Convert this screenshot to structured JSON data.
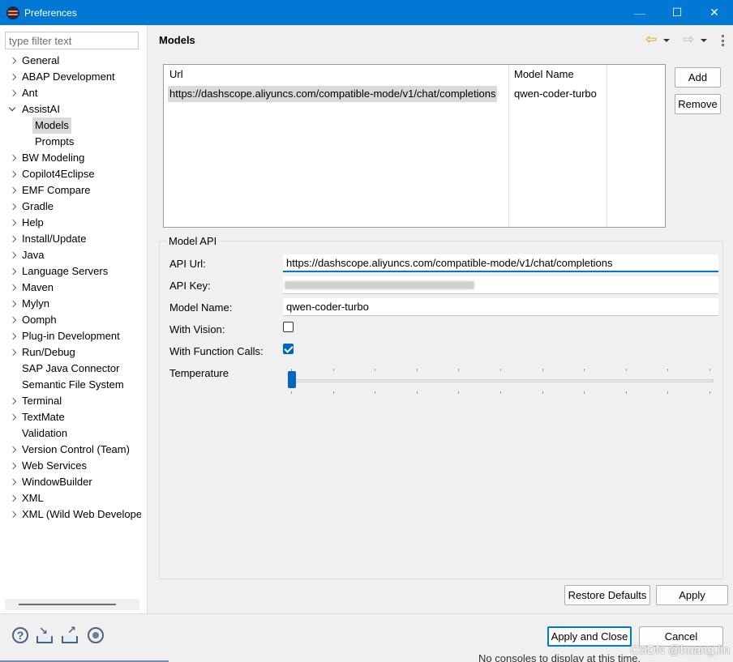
{
  "window": {
    "title": "Preferences",
    "minimize_glyph": "—",
    "maximize_glyph": "☐",
    "close_glyph": "✕"
  },
  "filter": {
    "placeholder": "type filter text",
    "value": ""
  },
  "tree": [
    {
      "label": "General",
      "arrow": "collapsed"
    },
    {
      "label": "ABAP Development",
      "arrow": "collapsed"
    },
    {
      "label": "Ant",
      "arrow": "collapsed"
    },
    {
      "label": "AssistAI",
      "arrow": "expanded"
    },
    {
      "label": "Models",
      "arrow": "none",
      "child": true,
      "selected": true
    },
    {
      "label": "Prompts",
      "arrow": "none",
      "child": true
    },
    {
      "label": "BW Modeling",
      "arrow": "collapsed"
    },
    {
      "label": "Copilot4Eclipse",
      "arrow": "collapsed"
    },
    {
      "label": "EMF Compare",
      "arrow": "collapsed"
    },
    {
      "label": "Gradle",
      "arrow": "collapsed"
    },
    {
      "label": "Help",
      "arrow": "collapsed"
    },
    {
      "label": "Install/Update",
      "arrow": "collapsed"
    },
    {
      "label": "Java",
      "arrow": "collapsed"
    },
    {
      "label": "Language Servers",
      "arrow": "collapsed"
    },
    {
      "label": "Maven",
      "arrow": "collapsed"
    },
    {
      "label": "Mylyn",
      "arrow": "collapsed"
    },
    {
      "label": "Oomph",
      "arrow": "collapsed"
    },
    {
      "label": "Plug-in Development",
      "arrow": "collapsed"
    },
    {
      "label": "Run/Debug",
      "arrow": "collapsed"
    },
    {
      "label": "SAP Java Connector",
      "arrow": "none"
    },
    {
      "label": "Semantic File System",
      "arrow": "none"
    },
    {
      "label": "Terminal",
      "arrow": "collapsed"
    },
    {
      "label": "TextMate",
      "arrow": "collapsed"
    },
    {
      "label": "Validation",
      "arrow": "none"
    },
    {
      "label": "Version Control (Team)",
      "arrow": "collapsed"
    },
    {
      "label": "Web Services",
      "arrow": "collapsed"
    },
    {
      "label": "WindowBuilder",
      "arrow": "collapsed"
    },
    {
      "label": "XML",
      "arrow": "collapsed"
    },
    {
      "label": "XML (Wild Web Develope",
      "arrow": "collapsed"
    }
  ],
  "page": {
    "title": "Models"
  },
  "models_table": {
    "headers": {
      "url": "Url",
      "model_name": "Model Name"
    },
    "rows": [
      {
        "url": "https://dashscope.aliyuncs.com/compatible-mode/v1/chat/completions",
        "model_name": "qwen-coder-turbo"
      }
    ]
  },
  "table_buttons": {
    "add": "Add",
    "remove": "Remove"
  },
  "model_api": {
    "group_title": "Model API",
    "api_url_label": "API Url:",
    "api_url_value": "https://dashscope.aliyuncs.com/compatible-mode/v1/chat/completions",
    "api_key_label": "API Key:",
    "model_name_label": "Model Name:",
    "model_name_value": "qwen-coder-turbo",
    "with_vision_label": "With Vision:",
    "with_vision_checked": false,
    "with_function_calls_label": "With Function Calls:",
    "with_function_calls_checked": true,
    "temperature_label": "Temperature",
    "temperature_position": 0
  },
  "page_buttons": {
    "restore_defaults": "Restore Defaults",
    "apply": "Apply"
  },
  "dialog_buttons": {
    "apply_and_close": "Apply and Close",
    "cancel": "Cancel"
  },
  "background_text": "No consoles to display at this time.",
  "watermark": "CSDN @huang.lin",
  "colors": {
    "accent": "#0078d4",
    "title_bar": "#0078d4",
    "checkbox_on": "#0067c0"
  }
}
